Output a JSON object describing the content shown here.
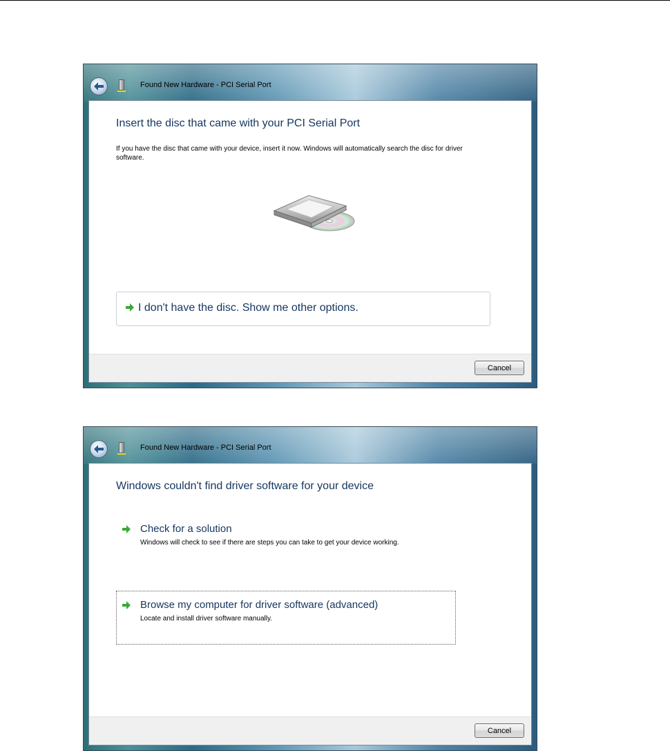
{
  "dialog_1": {
    "title": "Found New Hardware - PCI Serial Port",
    "instruction": "Insert the disc that came with your PCI Serial Port",
    "description": "If you have the disc that came with your device, insert it now.  Windows will automatically search the disc for driver software.",
    "option": {
      "label": "I don't have the disc.  Show me other options.",
      "icon": "green-arrow-icon"
    },
    "cancel_label": "Cancel",
    "illustration": "disc-drive-icon"
  },
  "dialog_2": {
    "title": "Found New Hardware - PCI Serial Port",
    "instruction": "Windows couldn't find driver software for your device",
    "options": [
      {
        "label": "Check for a solution",
        "description": "Windows will check to see if there are steps you can take to get your device working.",
        "icon": "green-arrow-icon"
      },
      {
        "label": "Browse my computer for driver software (advanced)",
        "description": "Locate and install driver software manually.",
        "icon": "green-arrow-icon"
      }
    ],
    "cancel_label": "Cancel"
  },
  "colors": {
    "instruction_text": "#14355f",
    "arrow_green": "#3aa83a",
    "footer_bg": "#f0f0f0"
  }
}
